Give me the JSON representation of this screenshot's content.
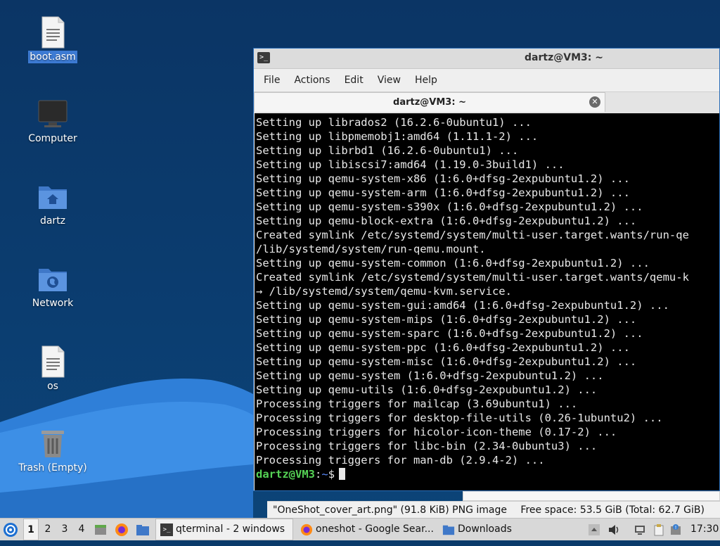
{
  "desktop": {
    "icons": [
      {
        "label": "boot.asm",
        "type": "text-file-icon",
        "selected": true
      },
      {
        "label": "Computer",
        "type": "monitor-icon"
      },
      {
        "label": "dartz",
        "type": "home-folder-icon"
      },
      {
        "label": "Network",
        "type": "network-folder-icon"
      },
      {
        "label": "os",
        "type": "text-file-icon"
      },
      {
        "label": "Trash (Empty)",
        "type": "trash-icon"
      }
    ]
  },
  "terminal": {
    "window_title": "dartz@VM3: ~",
    "menu": [
      "File",
      "Actions",
      "Edit",
      "View",
      "Help"
    ],
    "tab_title": "dartz@VM3: ~",
    "lines": [
      "Setting up librados2 (16.2.6-0ubuntu1) ...",
      "Setting up libpmemobj1:amd64 (1.11.1-2) ...",
      "Setting up librbd1 (16.2.6-0ubuntu1) ...",
      "Setting up libiscsi7:amd64 (1.19.0-3build1) ...",
      "Setting up qemu-system-x86 (1:6.0+dfsg-2expubuntu1.2) ...",
      "Setting up qemu-system-arm (1:6.0+dfsg-2expubuntu1.2) ...",
      "Setting up qemu-system-s390x (1:6.0+dfsg-2expubuntu1.2) ...",
      "Setting up qemu-block-extra (1:6.0+dfsg-2expubuntu1.2) ...",
      "Created symlink /etc/systemd/system/multi-user.target.wants/run-qe",
      "/lib/systemd/system/run-qemu.mount.",
      "Setting up qemu-system-common (1:6.0+dfsg-2expubuntu1.2) ...",
      "Created symlink /etc/systemd/system/multi-user.target.wants/qemu-k",
      "→ /lib/systemd/system/qemu-kvm.service.",
      "Setting up qemu-system-gui:amd64 (1:6.0+dfsg-2expubuntu1.2) ...",
      "Setting up qemu-system-mips (1:6.0+dfsg-2expubuntu1.2) ...",
      "Setting up qemu-system-sparc (1:6.0+dfsg-2expubuntu1.2) ...",
      "Setting up qemu-system-ppc (1:6.0+dfsg-2expubuntu1.2) ...",
      "Setting up qemu-system-misc (1:6.0+dfsg-2expubuntu1.2) ...",
      "Setting up qemu-system (1:6.0+dfsg-2expubuntu1.2) ...",
      "Setting up qemu-utils (1:6.0+dfsg-2expubuntu1.2) ...",
      "Processing triggers for mailcap (3.69ubuntu1) ...",
      "Processing triggers for desktop-file-utils (0.26-1ubuntu2) ...",
      "Processing triggers for hicolor-icon-theme (0.17-2) ...",
      "Processing triggers for libc-bin (2.34-0ubuntu3) ...",
      "Processing triggers for man-db (2.9.4-2) ..."
    ],
    "prompt": {
      "user_host": "dartz@VM3",
      "separator": ":",
      "dir": "~",
      "symbol": "$"
    }
  },
  "file_manager_status": {
    "selection": "\"OneShot_cover_art.png\" (91.8 KiB) PNG image",
    "free_space": "Free space: 53.5 GiB (Total: 62.7 GiB)"
  },
  "taskbar": {
    "workspaces": [
      "1",
      "2",
      "3",
      "4"
    ],
    "active_workspace": "1",
    "tasks": [
      {
        "label": "qterminal - 2 windows",
        "icon": "terminal-icon"
      },
      {
        "label": "oneshot - Google Sear...",
        "icon": "firefox-icon"
      },
      {
        "label": "Downloads",
        "icon": "folder-icon"
      }
    ],
    "clock": "17:30"
  },
  "colors": {
    "desktop_bg": "#0b3565",
    "wave_light": "#3d8fe6",
    "prompt_user": "#55d255",
    "prompt_dir": "#5a8cff",
    "selection": "#3d7bd4"
  }
}
